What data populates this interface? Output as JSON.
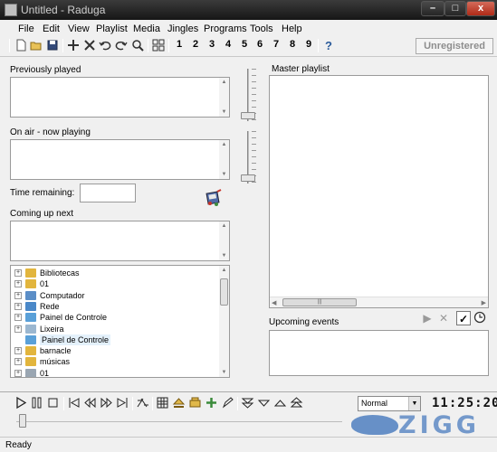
{
  "window": {
    "title": "Untitled - Raduga",
    "controls": {
      "minimize": "–",
      "maximize": "□",
      "close": "x"
    }
  },
  "menu": [
    "File",
    "Edit",
    "View",
    "Playlist",
    "Media",
    "Jingles",
    "Programs",
    "Tools",
    "Help"
  ],
  "toolbar": {
    "icons": [
      "new-icon",
      "open-icon",
      "save-icon",
      "add-icon",
      "delete-icon",
      "undo-icon",
      "redo-icon",
      "find-icon",
      "jingle-grid-icon"
    ],
    "jingle_numbers": [
      "1",
      "2",
      "3",
      "4",
      "5",
      "6",
      "7",
      "8",
      "9"
    ],
    "help_icon": "help-icon",
    "registration": "Unregistered"
  },
  "panels": {
    "previously_played": "Previously played",
    "on_air": "On air - now playing",
    "time_remaining": "Time remaining:",
    "coming_up_next": "Coming up next",
    "master_playlist": "Master playlist",
    "upcoming_events": "Upcoming events"
  },
  "tree": [
    {
      "label": "Bibliotecas",
      "icon": "folder-icon",
      "color": "#e2b53d",
      "expandable": true
    },
    {
      "label": "01",
      "icon": "folder-icon",
      "color": "#e2b53d",
      "expandable": true
    },
    {
      "label": "Computador",
      "icon": "computer-icon",
      "color": "#5b8ec7",
      "expandable": true
    },
    {
      "label": "Rede",
      "icon": "network-icon",
      "color": "#4a88c8",
      "expandable": true
    },
    {
      "label": "Painel de Controle",
      "icon": "control-panel-icon",
      "color": "#5aa0d8",
      "expandable": true
    },
    {
      "label": "Lixeira",
      "icon": "recycle-bin-icon",
      "color": "#9bb7d0",
      "expandable": true
    },
    {
      "label": "Painel de Controle",
      "icon": "control-panel-icon",
      "color": "#5aa0d8",
      "expandable": false,
      "selected": true
    },
    {
      "label": "barnacle",
      "icon": "folder-icon",
      "color": "#e2b53d",
      "expandable": true
    },
    {
      "label": "músicas",
      "icon": "folder-icon",
      "color": "#e2b53d",
      "expandable": true
    },
    {
      "label": "01",
      "icon": "folder-icon",
      "color": "#9aa6b2",
      "expandable": true
    }
  ],
  "transport": {
    "mode": "Normal",
    "clock": "11:25:20"
  },
  "status": "Ready",
  "watermark": "ZIGG"
}
